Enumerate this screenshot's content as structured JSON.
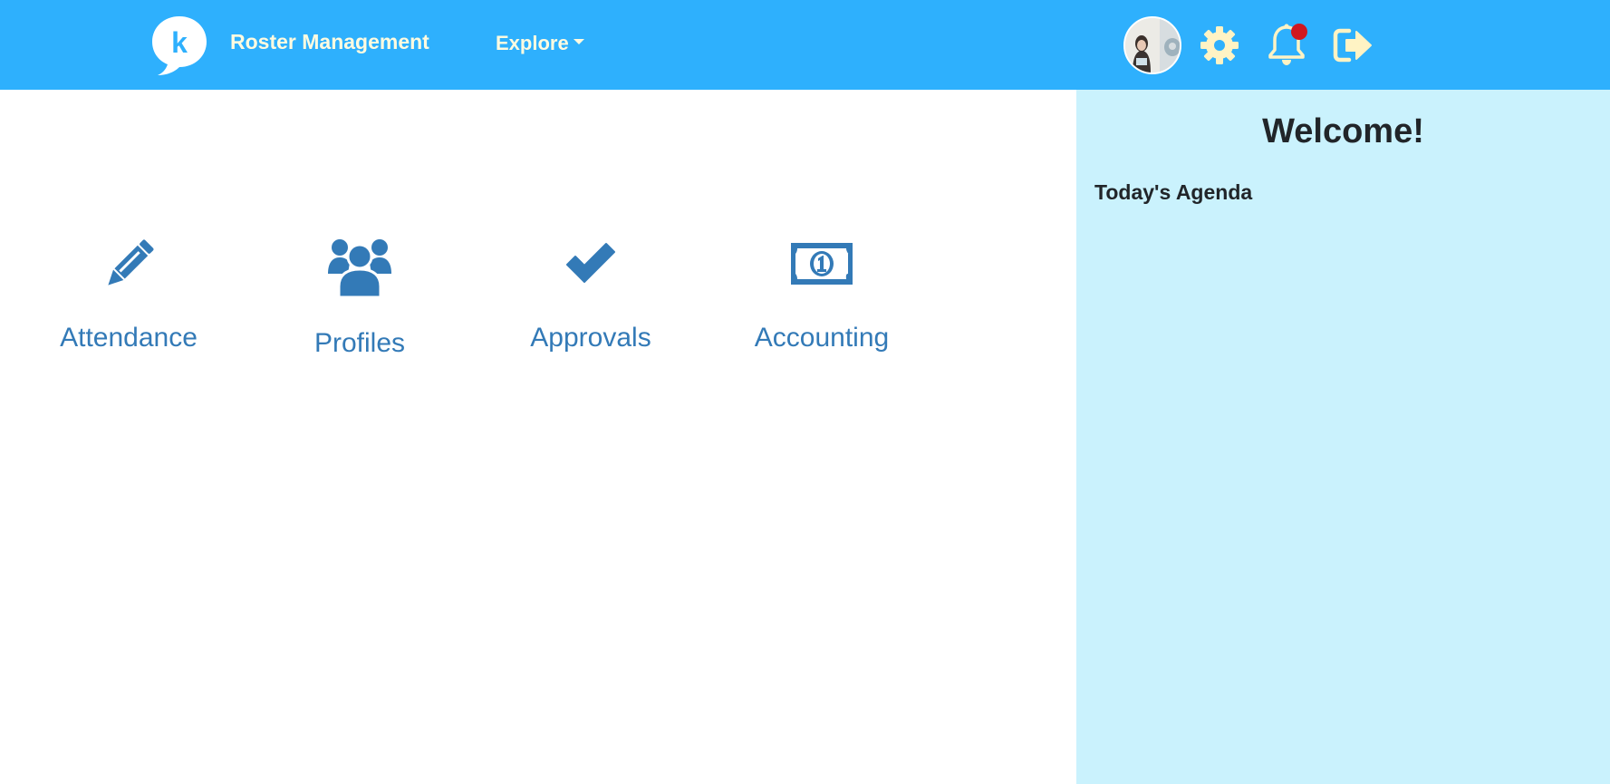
{
  "header": {
    "logo_letter": "k",
    "app_title": "Roster Management",
    "explore_label": "Explore",
    "icons": [
      "avatar",
      "gear-icon",
      "bell-icon",
      "logout-icon"
    ],
    "notification_dot_color": "#d0171f"
  },
  "tiles": [
    {
      "label": "Attendance",
      "icon": "pencil-icon"
    },
    {
      "label": "Profiles",
      "icon": "users-icon"
    },
    {
      "label": "Approvals",
      "icon": "check-icon"
    },
    {
      "label": "Accounting",
      "icon": "money-icon"
    }
  ],
  "sidebar": {
    "welcome": "Welcome!",
    "agenda_title": "Today's Agenda"
  },
  "colors": {
    "header_bg": "#2eb0fd",
    "header_text": "#fffbe0",
    "tile_color": "#337ab7",
    "panel_bg": "#caf2fd"
  }
}
